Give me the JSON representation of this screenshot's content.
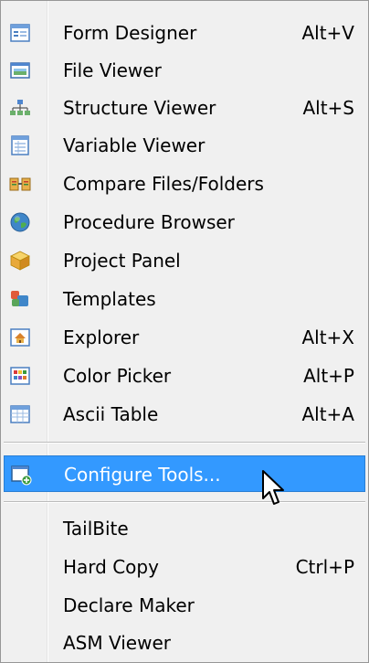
{
  "menu": {
    "items": [
      {
        "label": "Form Designer",
        "shortcut": "Alt+V",
        "icon": "form-designer-icon"
      },
      {
        "label": "File Viewer",
        "shortcut": "",
        "icon": "file-viewer-icon"
      },
      {
        "label": "Structure Viewer",
        "shortcut": "Alt+S",
        "icon": "structure-viewer-icon"
      },
      {
        "label": "Variable Viewer",
        "shortcut": "",
        "icon": "variable-viewer-icon"
      },
      {
        "label": "Compare Files/Folders",
        "shortcut": "",
        "icon": "compare-files-icon"
      },
      {
        "label": "Procedure Browser",
        "shortcut": "",
        "icon": "globe-icon"
      },
      {
        "label": "Project Panel",
        "shortcut": "",
        "icon": "cube-icon"
      },
      {
        "label": "Templates",
        "shortcut": "",
        "icon": "templates-icon"
      },
      {
        "label": "Explorer",
        "shortcut": "Alt+X",
        "icon": "explorer-icon"
      },
      {
        "label": "Color Picker",
        "shortcut": "Alt+P",
        "icon": "color-picker-icon"
      },
      {
        "label": "Ascii Table",
        "shortcut": "Alt+A",
        "icon": "ascii-table-icon"
      }
    ],
    "highlighted": {
      "label": "Configure Tools...",
      "shortcut": "",
      "icon": "configure-tools-icon"
    },
    "tools": [
      {
        "label": "TailBite",
        "shortcut": ""
      },
      {
        "label": "Hard Copy",
        "shortcut": "Ctrl+P"
      },
      {
        "label": "Declare Maker",
        "shortcut": ""
      },
      {
        "label": "ASM Viewer",
        "shortcut": ""
      }
    ]
  },
  "colors": {
    "menu_background": "#f0f0f0",
    "highlight": "#3399ff",
    "border": "#979797"
  }
}
